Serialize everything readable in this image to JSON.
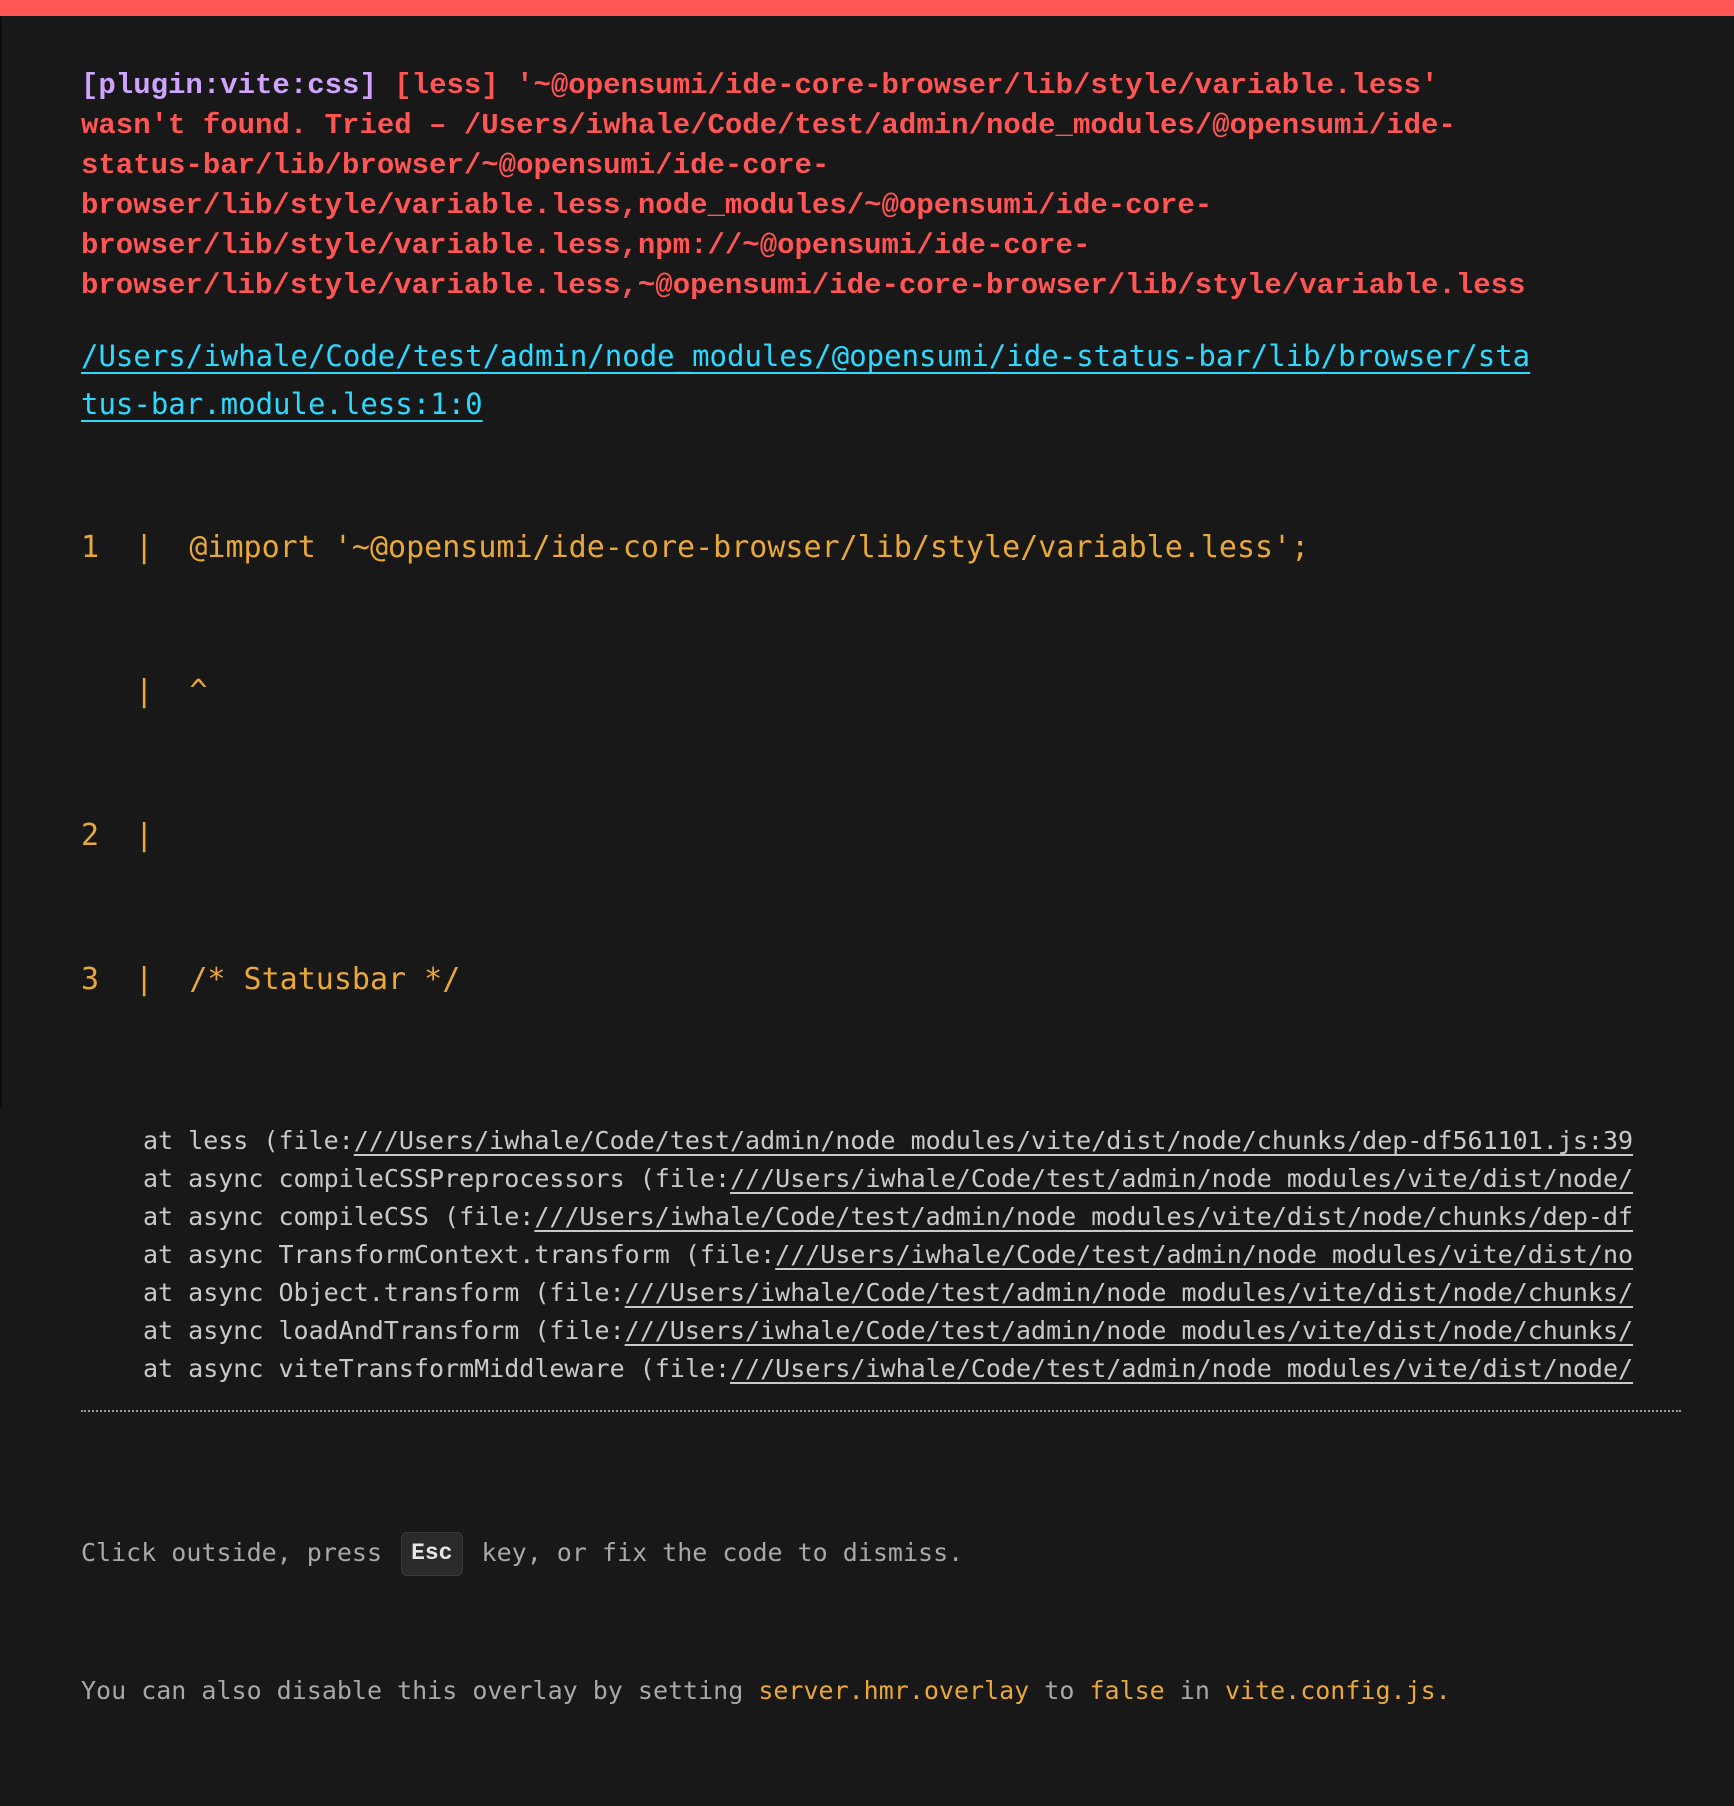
{
  "error": {
    "plugin": "[plugin:vite:css]",
    "message_lines": [
      " [less] '~@opensumi/ide-core-browser/lib/style/variable.less'",
      "wasn't found. Tried – /Users/iwhale/Code/test/admin/node_modules/@opensumi/ide-",
      "status-bar/lib/browser/~@opensumi/ide-core-",
      "browser/lib/style/variable.less,node_modules/~@opensumi/ide-core-",
      "browser/lib/style/variable.less,npm://~@opensumi/ide-core-",
      "browser/lib/style/variable.less,~@opensumi/ide-core-browser/lib/style/variable.less"
    ]
  },
  "file": {
    "line1": "/Users/iwhale/Code/test/admin/node_modules/@opensumi/ide-status-bar/lib/browser/sta",
    "line2": "tus-bar.module.less:1:0"
  },
  "frame": [
    "1  |  @import '~@opensumi/ide-core-browser/lib/style/variable.less';",
    "   |  ^",
    "2  |",
    "3  |  /* Statusbar */"
  ],
  "stack": [
    {
      "prefix": "at less (file:",
      "url": "///Users/iwhale/Code/test/admin/node_modules/vite/dist/node/chunks/dep-df561101.js:39"
    },
    {
      "prefix": "at async compileCSSPreprocessors (file:",
      "url": "///Users/iwhale/Code/test/admin/node_modules/vite/dist/node/"
    },
    {
      "prefix": "at async compileCSS (file:",
      "url": "///Users/iwhale/Code/test/admin/node_modules/vite/dist/node/chunks/dep-df"
    },
    {
      "prefix": "at async TransformContext.transform (file:",
      "url": "///Users/iwhale/Code/test/admin/node_modules/vite/dist/no"
    },
    {
      "prefix": "at async Object.transform (file:",
      "url": "///Users/iwhale/Code/test/admin/node_modules/vite/dist/node/chunks/"
    },
    {
      "prefix": "at async loadAndTransform (file:",
      "url": "///Users/iwhale/Code/test/admin/node_modules/vite/dist/node/chunks/"
    },
    {
      "prefix": "at async viteTransformMiddleware (file:",
      "url": "///Users/iwhale/Code/test/admin/node_modules/vite/dist/node/"
    }
  ],
  "tip": {
    "line1_before": "Click outside, press ",
    "key": "Esc",
    "line1_after": " key, or fix the code to dismiss.",
    "line2_before": "You can also disable this overlay by setting ",
    "setting": "server.hmr.overlay",
    "to": " to ",
    "value": "false",
    "in": " in ",
    "config": "vite.config.js",
    "period": "."
  },
  "colors": {
    "accent": "#ff5555",
    "plugin": "#cfa4ff",
    "link": "#2dd9fe",
    "frame": "#e9a83a",
    "background": "#181818"
  }
}
